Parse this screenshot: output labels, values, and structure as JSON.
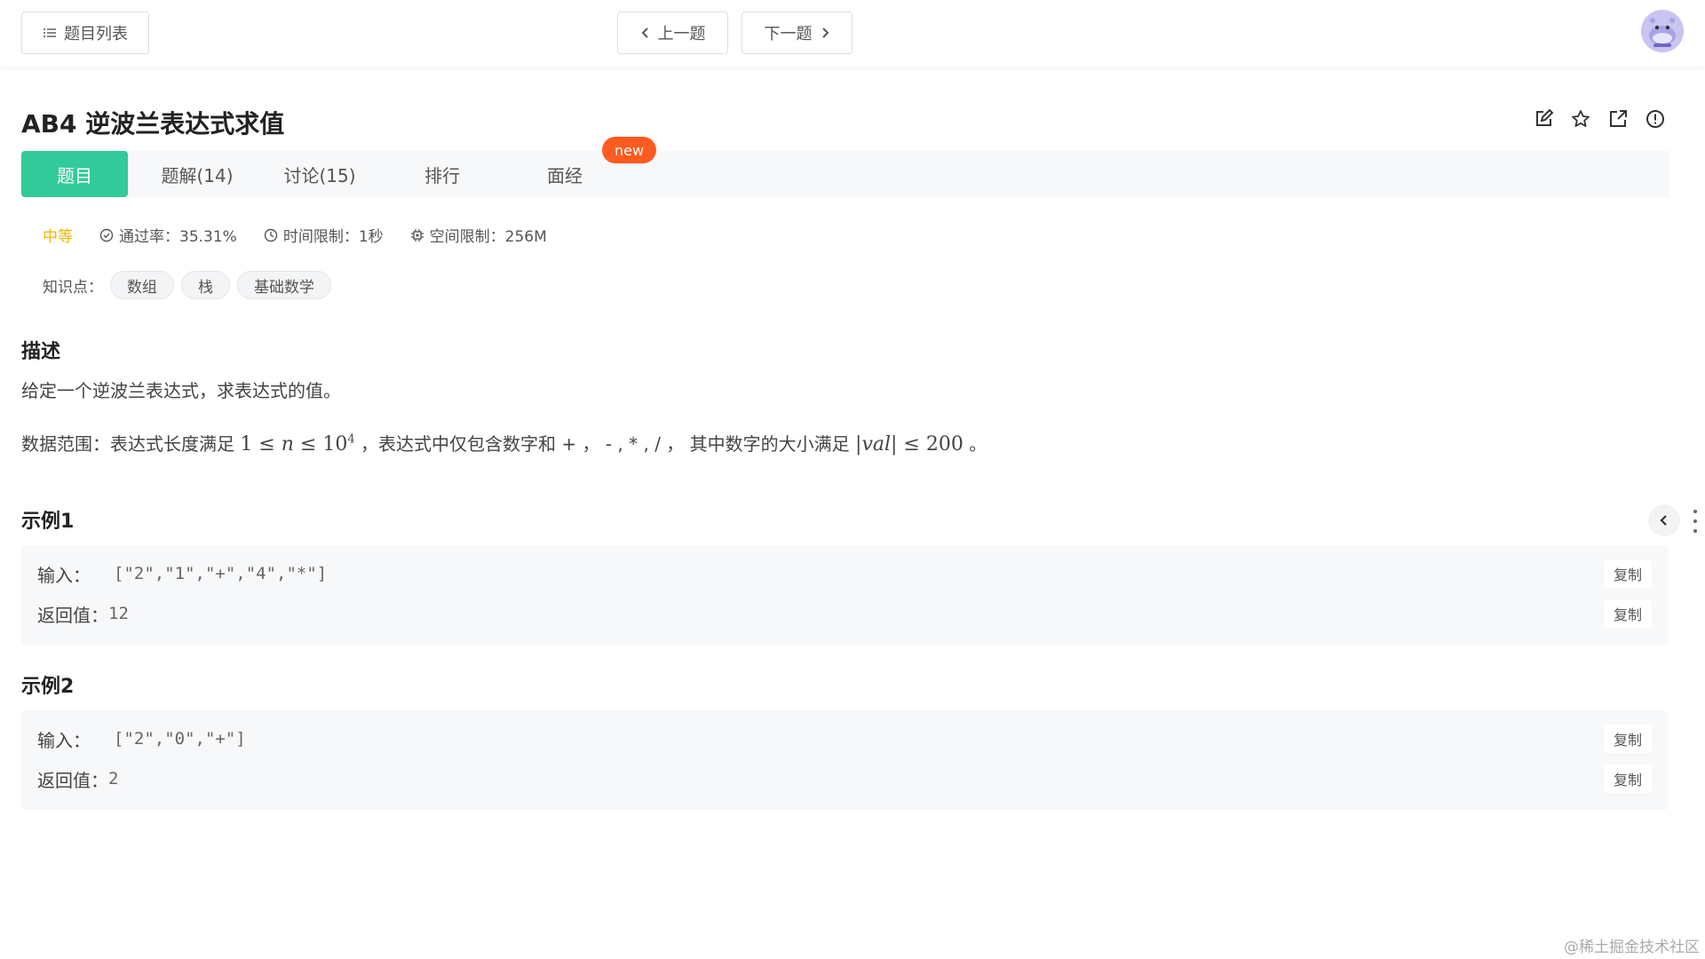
{
  "topbar": {
    "list_button": "题目列表",
    "prev_button": "上一题",
    "next_button": "下一题"
  },
  "problem": {
    "title": "AB4  逆波兰表达式求值",
    "tabs": [
      {
        "label": "题目",
        "active": true
      },
      {
        "label": "题解(14)",
        "active": false
      },
      {
        "label": "讨论(15)",
        "active": false
      },
      {
        "label": "排行",
        "active": false
      },
      {
        "label": "面经",
        "active": false
      }
    ],
    "new_badge": "new",
    "difficulty": "中等",
    "pass_rate": "通过率：35.31%",
    "time_limit": "时间限制：1秒",
    "space_limit": "空间限制：256M",
    "knowledge_label": "知识点：",
    "tags": [
      "数组",
      "栈",
      "基础数学"
    ]
  },
  "description": {
    "heading": "描述",
    "text": "给定一个逆波兰表达式，求表达式的值。",
    "range_prefix": "数据范围：表达式长度满足 ",
    "range_mid": "，表达式中仅包含数字和 + ，  - , * , / ，  其中数字的大小满足 ",
    "range_suffix": "。"
  },
  "examples": [
    {
      "heading": "示例1",
      "input_label": "输入：",
      "input": "[\"2\",\"1\",\"+\",\"4\",\"*\"]",
      "output_label": "返回值：",
      "output": "12",
      "copy": "复制"
    },
    {
      "heading": "示例2",
      "input_label": "输入：",
      "input": "[\"2\",\"0\",\"+\"]",
      "output_label": "返回值：",
      "output": "2",
      "copy": "复制"
    }
  ],
  "watermark": "@稀土掘金技术社区",
  "colors": {
    "accent": "#32ca99",
    "new_badge": "#ff5a1f",
    "difficulty": "#f0b400"
  }
}
